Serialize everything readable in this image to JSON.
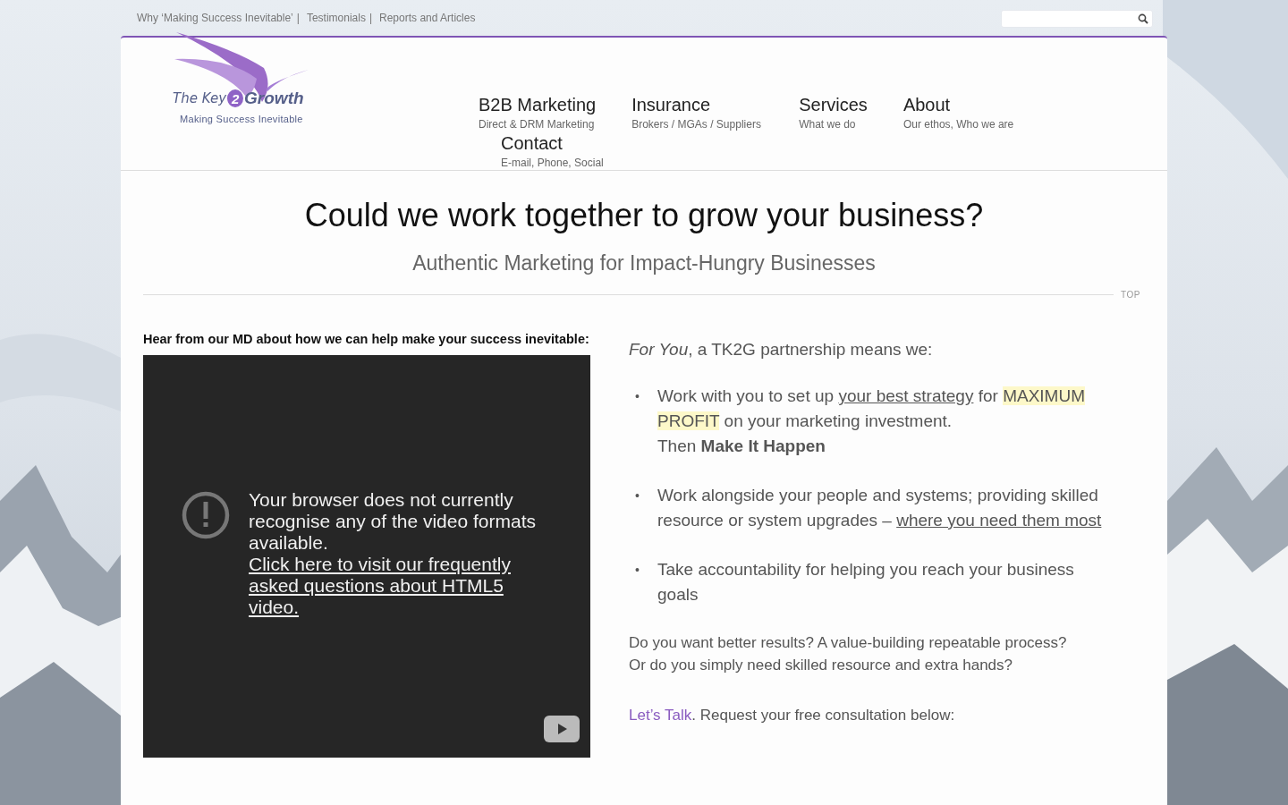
{
  "top_links": [
    {
      "label": "Why ‘Making Success Inevitable’",
      "separator": "|"
    },
    {
      "label": "Testimonials",
      "separator": "|"
    },
    {
      "label": "Reports and Articles"
    }
  ],
  "logo": {
    "word_1": "The Key",
    "digit": "2",
    "word_2": "Growth",
    "tagline": "Making Success Inevitable"
  },
  "nav": [
    {
      "title": "B2B Marketing",
      "subtitle": "Direct & DRM Marketing"
    },
    {
      "title": "Insurance",
      "subtitle": "Brokers / MGAs / Suppliers"
    },
    {
      "title": "Services",
      "subtitle": "What we do"
    },
    {
      "title": "About",
      "subtitle": "Our ethos, Who we are"
    },
    {
      "title": "Contact",
      "subtitle": "E-mail, Phone, Social"
    }
  ],
  "headline": "Could we work together to grow your business?",
  "subheadline": "Authentic Marketing for Impact-Hungry Businesses",
  "top_link": "TOP",
  "video_heading": "Hear from our MD about how we can help make your success inevitable:",
  "video": {
    "message": "Your browser does not currently recognise any of the video formats available.",
    "link": "Click here to visit our frequently asked questions about HTML5 video."
  },
  "intro": "*For You*, a TK2G partnership means we:",
  "bullets": [
    {
      "marker": "•",
      "segments": [
        {
          "kind": "text",
          "text": "Work with you to set up "
        },
        {
          "kind": "link",
          "text": "your best strategy"
        },
        {
          "kind": "text",
          "text": " for "
        },
        {
          "kind": "highlight",
          "text": "MAXIMUM PROFIT"
        },
        {
          "kind": "text",
          "text": " on your marketing investment."
        },
        {
          "kind": "line",
          "text": "Then **Make It Happen**"
        }
      ]
    },
    {
      "marker": "•",
      "segments": [
        {
          "kind": "text",
          "text": "Work alongside your people and systems; providing skilled resource or system upgrades – "
        },
        {
          "kind": "link",
          "text": "where you need them most"
        }
      ]
    },
    {
      "marker": "•",
      "segments": [
        {
          "kind": "text",
          "text": "Take accountability for helping you reach your business goals"
        }
      ]
    }
  ],
  "questions": [
    {
      "text": "Do you want better results? A value-building repeatable process?"
    },
    {
      "text": "Or do you simply need skilled resource and extra hands?"
    }
  ],
  "cta": [
    {
      "kind": "accent",
      "text": "Let’s Talk"
    },
    {
      "kind": "text",
      "text": ". Request your free consultation below:"
    }
  ]
}
